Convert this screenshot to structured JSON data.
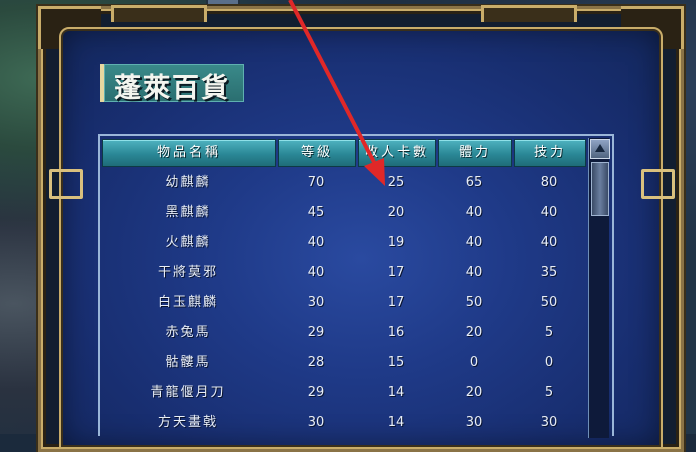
{
  "shop": {
    "title": "蓬萊百貨"
  },
  "table": {
    "headers": [
      "物品名稱",
      "等級",
      "收人卡數",
      "體力",
      "技力"
    ],
    "rows": [
      {
        "name": "幼麒麟",
        "level": "70",
        "cards": "25",
        "hp": "65",
        "skill": "80"
      },
      {
        "name": "黑麒麟",
        "level": "45",
        "cards": "20",
        "hp": "40",
        "skill": "40"
      },
      {
        "name": "火麒麟",
        "level": "40",
        "cards": "19",
        "hp": "40",
        "skill": "40"
      },
      {
        "name": "干將莫邪",
        "level": "40",
        "cards": "17",
        "hp": "40",
        "skill": "35"
      },
      {
        "name": "白玉麒麟",
        "level": "30",
        "cards": "17",
        "hp": "50",
        "skill": "50"
      },
      {
        "name": "赤兔馬",
        "level": "29",
        "cards": "16",
        "hp": "20",
        "skill": "5"
      },
      {
        "name": "骷髏馬",
        "level": "28",
        "cards": "15",
        "hp": "0",
        "skill": "0"
      },
      {
        "name": "青龍偃月刀",
        "level": "29",
        "cards": "14",
        "hp": "20",
        "skill": "5"
      },
      {
        "name": "方天畫戟",
        "level": "30",
        "cards": "14",
        "hp": "30",
        "skill": "30"
      }
    ]
  },
  "colors": {
    "frame_gold": "#c9ad6a",
    "panel_blue": "#1f3a88",
    "header_teal": "#2a8796",
    "arrow_red": "#e02828"
  },
  "icons": {
    "scroll_up": "triangle-up"
  }
}
